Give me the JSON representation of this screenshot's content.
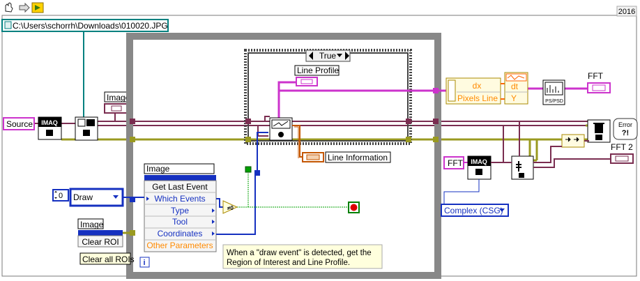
{
  "toolbar": {
    "icons": [
      "hand-icon",
      "arrow-right-icon",
      "run-highlight-icon"
    ],
    "version": "2016"
  },
  "path_constant": "C:\\Users\\schorrh\\Downloads\\010020.JPG",
  "labels": {
    "source": "Source",
    "image_indicator_top": "Image",
    "line_profile": "Line Profile",
    "line_information": "Line Information",
    "fft": "FFT",
    "fft2": "FFT 2",
    "fft_control": "FFT",
    "error_label": "Error"
  },
  "case_structure": {
    "selector": "True"
  },
  "event_node": {
    "image_label": "Image",
    "items": [
      "Get Last Event",
      "Which Events",
      "Type",
      "Tool",
      "Coordinates",
      "Other Parameters"
    ]
  },
  "numeric": {
    "value": "0"
  },
  "draw_enum": {
    "value": "Draw"
  },
  "clear_roi": {
    "image_label": "Image",
    "node_label": "Clear ROI",
    "constant": "Clear all ROIs"
  },
  "compare": {
    "label": "≠0"
  },
  "comment": "When a \"draw event\" is detected, get the Region of Interest and Line Profile.",
  "build_waveform": {
    "dx": "dx",
    "pixels_line": "Pixels Line",
    "dt": "dt",
    "y": "Y"
  },
  "spectrum": {
    "label": "PS/PSD"
  },
  "complex_enum": {
    "value": "Complex (CSG)"
  },
  "node_icons": {
    "imaq_read": "IMAQ",
    "imaq_fft": "IMAQ",
    "imaq_file": "file",
    "info_i": "i",
    "error_cluster": "Error"
  },
  "colors": {
    "image_wire": "#7a2d50",
    "error_wire": "#9a9a20",
    "dbl_wire": "#ff6600",
    "enum_wire": "#1530c0",
    "bool_wire": "#00a000",
    "path_wire": "#00807f",
    "waveform_wire": "#cc33cc",
    "struct_gray": "#888888",
    "case_border": "#444444"
  }
}
